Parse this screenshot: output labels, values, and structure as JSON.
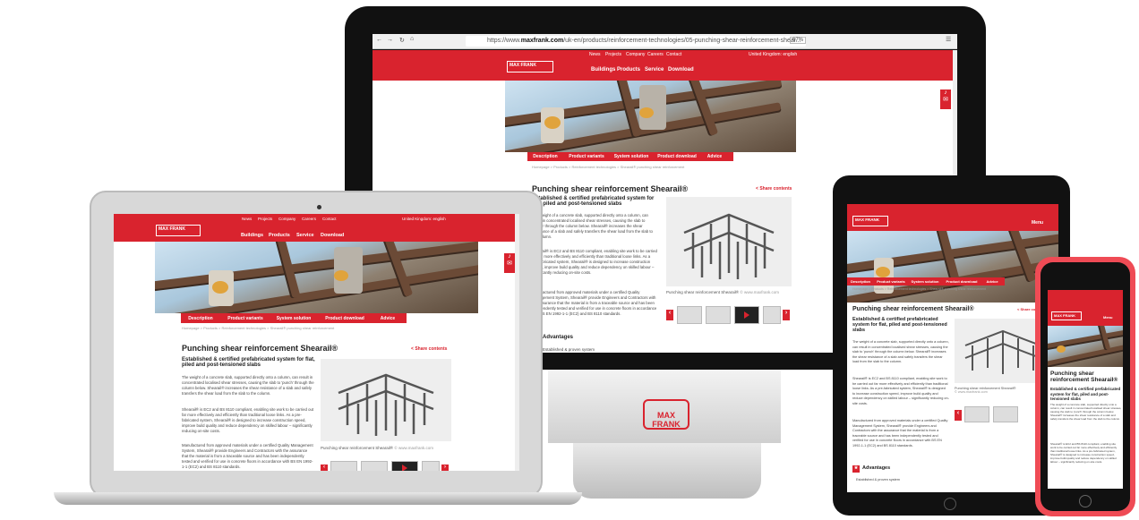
{
  "browser": {
    "url_prefix": "https://www.",
    "url_domain": "maxfrank.com",
    "url_path": "/uk-en/products/reinforcement-technologies/05-punching-shear-reinforcement-shear...",
    "zoom": "67%"
  },
  "site": {
    "logo_brand": "MAX FRANK",
    "logo_tagline": "BUILDING COMMON GROUND",
    "topnav": [
      "News",
      "Projects",
      "Company",
      "Careers",
      "Contact"
    ],
    "language": "United Kingdom: english",
    "mainnav": [
      "Buildings",
      "Products",
      "Service",
      "Download"
    ],
    "menu_label": "Menu",
    "tabs": [
      "Description",
      "Product variants",
      "System solution",
      "Product download",
      "Advice"
    ],
    "breadcrumb": "Homepage > Products > Reinforcement technologies > Shearail® punching shear reinforcement",
    "title": "Punching shear reinforcement Shearail®",
    "share": "Share contents",
    "subtitle": "Established & certified prefabricated system for flat, piled and post-tensioned slabs",
    "para1": "The weight of a concrete slab, supported directly onto a column, can result in concentrated localised shear stresses, causing the slab to 'punch' through the column below. Shearail® increases the shear resistance of a slab and safely transfers the shear load from the slab to the column.",
    "para2": "Shearail® is EC2 and BS 8110 compliant, enabling site work to be carried out far more effectively and efficiently than traditional loose links. As a pre-fabricated system, Shearail® is designed to increase construction speed, improve build quality and reduce dependency on skilled labour – significantly reducing on-site costs.",
    "para3": "Manufactured from approved materials under a certified Quality Management System, Shearail® provide Engineers and Contractors with the assurance that the material is from a traceable source and has been independently tested and verified for use in concrete floors in accordance with BS EN 1992-1-1 (EC2) and BS 8110 standards.",
    "caption": "Punching shear reinforcement Shearail®",
    "copyright": "© www.maxfrank.com",
    "advantages": "Advantages",
    "adv_item": "Established & proven system"
  },
  "monitor_logo": "MAX FRANK",
  "colors": {
    "brand_red": "#d9232e"
  }
}
